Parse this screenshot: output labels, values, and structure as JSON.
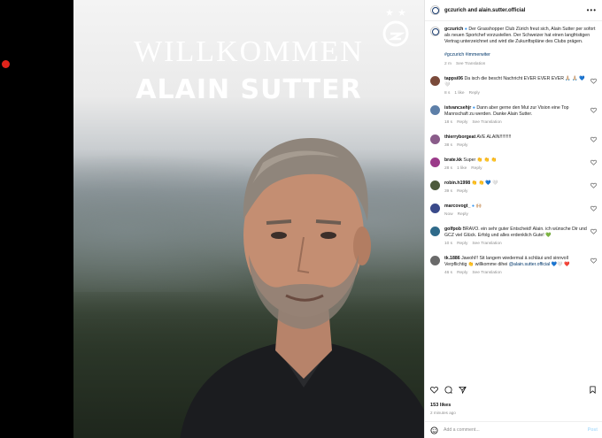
{
  "post": {
    "header": "gczurich and alain.sutter.official",
    "photo_title": "WILLKOMMEN",
    "photo_name": "ALAIN SUTTER",
    "caption_user": "gczurich",
    "caption_text": "Der Grasshopper Club Zürich freut sich, Alain Sutter per sofort als neuen Sportchef vorzustellen. Der Schweizer hat einen langfristigen Vertrag unterzeichnet und wird die Zukunftspläne des Clubs prägen.",
    "hashtags": "#gczurich #immerwiter",
    "caption_meta": [
      "2 m",
      "See Translation"
    ],
    "likes": "153 likes",
    "time_ago": "2 minutes ago",
    "add_comment_placeholder": "Add a comment...",
    "post_button": "Post"
  },
  "comments": [
    {
      "user": "tappsi06",
      "text": "Da isch die bescht Nachricht EVER EVER EVER 🙏🏼 🙏🏼 💙🤍",
      "meta": [
        "8 s",
        "1 like",
        "Reply"
      ],
      "avatar": "#7a4a3a"
    },
    {
      "user": "istvancsehjr",
      "text": "Dann aber gerne den Mut zur Vision eine Top Mannschaft zu werden. Danke Alain Sutter.",
      "meta": [
        "18 s",
        "Reply",
        "See Translation"
      ],
      "avatar": "#5d7fa8"
    },
    {
      "user": "thierryborgeat",
      "text": "AVE ALAIN!!!!!!!!!",
      "meta": [
        "38 s",
        "Reply"
      ],
      "avatar": "#8a5c8a"
    },
    {
      "user": "brate.kk",
      "text": "Super 👏 👏 👏",
      "meta": [
        "28 s",
        "1 like",
        "Reply"
      ],
      "avatar": "#9b3b8a"
    },
    {
      "user": "robin.h1998",
      "text": "👏 👏 💙 🤍",
      "meta": [
        "39 s",
        "Reply"
      ],
      "avatar": "#4d5a3c"
    },
    {
      "user": "marcovogt_",
      "text": "🙌🏼",
      "meta": [
        "Now",
        "Reply"
      ],
      "avatar": "#3a4a8a"
    },
    {
      "user": "golfpob",
      "text": "BRAVO. ein sehr guter Entscheid! Alain. ich wünsche Dir und GCZ viel Glück. Erfolg und alles erdenklich Gute! 💚",
      "meta": [
        "10 s",
        "Reply",
        "See Translation"
      ],
      "avatar": "#2f6a8a"
    },
    {
      "user": "tk.1886",
      "text": "Jawohl!! Sit langem wiedermal ä schläui und sinnvoll Verpflichtig 👏 willkomme dihei",
      "mention": "@alain.sutter.official",
      "text_tail": " 💙🤍 ❤️",
      "meta": [
        "46 s",
        "Reply",
        "See Translation"
      ],
      "avatar": "#6a6a6a"
    }
  ],
  "colors": {
    "accent_link": "#00376b",
    "meta_gray": "#8e8e8e",
    "post_button": "#b2dffc",
    "gc_blue": "#1a3c6e"
  },
  "icons": [
    "heart-icon",
    "comment-icon",
    "share-icon",
    "bookmark-icon",
    "more-icon",
    "emoji-icon",
    "gc-logo"
  ]
}
